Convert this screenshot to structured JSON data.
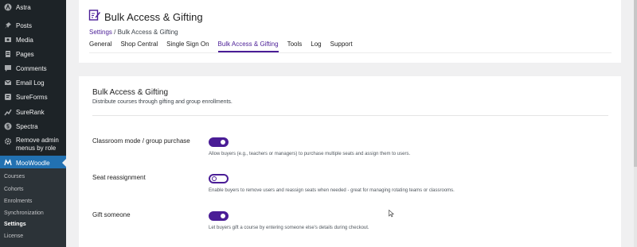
{
  "sidebar": {
    "items": [
      {
        "label": "Astra",
        "icon": "astra-icon"
      },
      {
        "label": "Posts",
        "icon": "pin-icon"
      },
      {
        "label": "Media",
        "icon": "media-icon"
      },
      {
        "label": "Pages",
        "icon": "pages-icon"
      },
      {
        "label": "Comments",
        "icon": "comment-icon"
      },
      {
        "label": "Email Log",
        "icon": "email-icon"
      },
      {
        "label": "SureForms",
        "icon": "sureforms-icon"
      },
      {
        "label": "SureRank",
        "icon": "surerank-icon"
      },
      {
        "label": "Spectra",
        "icon": "spectra-icon"
      },
      {
        "label": "Remove admin menus by role",
        "icon": "gear-icon"
      },
      {
        "label": "MooWoodle",
        "icon": "moowoodle-icon"
      }
    ],
    "submenu": [
      "Courses",
      "Cohorts",
      "Enrolments",
      "Synchronization",
      "Settings",
      "License"
    ],
    "current_submenu": "Settings"
  },
  "header": {
    "title": "Bulk Access & Gifting",
    "breadcrumb_link": "Settings",
    "breadcrumb_sep": " / ",
    "breadcrumb_current": "Bulk Access & Gifting",
    "tabs": [
      "General",
      "Shop Central",
      "Single Sign On",
      "Bulk Access & Gifting",
      "Tools",
      "Log",
      "Support"
    ],
    "active_tab": "Bulk Access & Gifting"
  },
  "section": {
    "title": "Bulk Access & Gifting",
    "description": "Distribute courses through gifting and group enrollments."
  },
  "settings": [
    {
      "label": "Classroom mode / group purchase",
      "enabled": true,
      "description": "Allow buyers (e.g., teachers or managers) to purchase multiple seats and assign them to users."
    },
    {
      "label": "Seat reassignment",
      "enabled": false,
      "description": "Enable buyers to remove users and reassign seats when needed - great for managing rotating teams or classrooms."
    },
    {
      "label": "Gift someone",
      "enabled": true,
      "description": "Let buyers gift a course by entering someone else's details during checkout."
    }
  ],
  "colors": {
    "accent": "#4a1d96",
    "sidebar_bg": "#1d2327",
    "sidebar_active": "#2271b1"
  }
}
